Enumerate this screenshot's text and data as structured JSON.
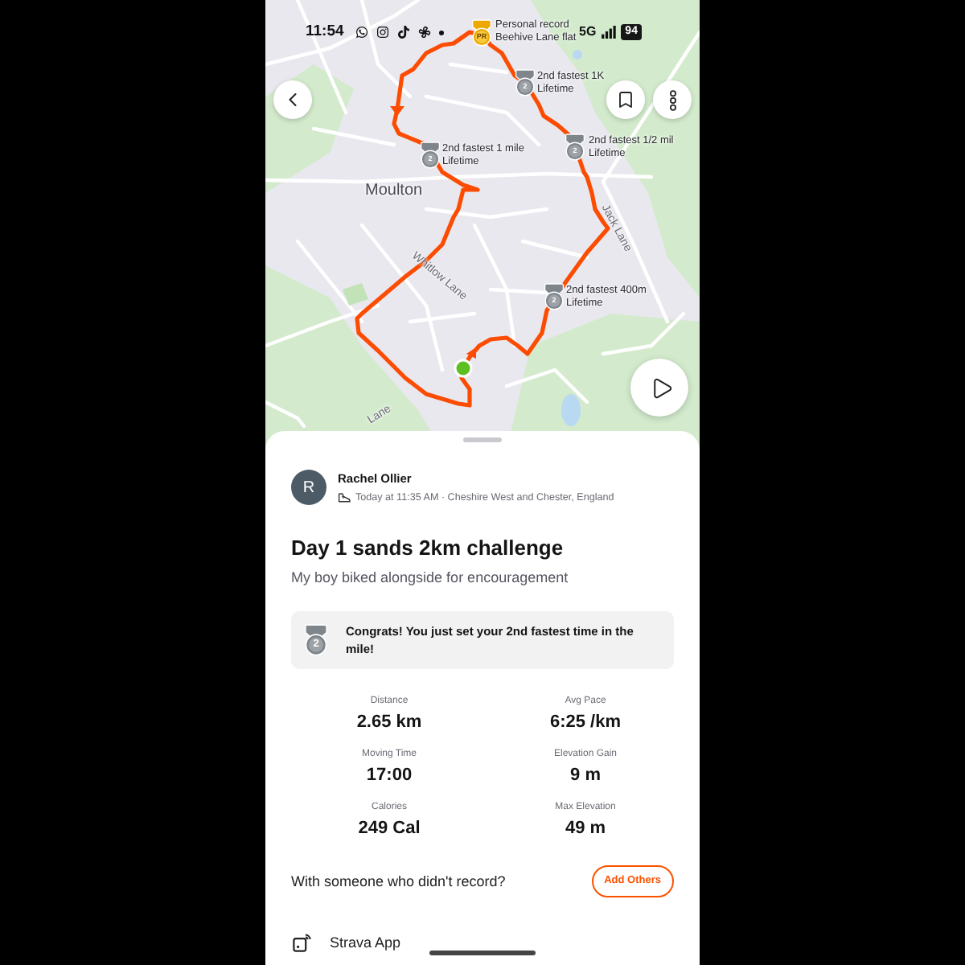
{
  "status_bar": {
    "time": "11:54",
    "network": "5G",
    "battery": "94"
  },
  "map": {
    "place_labels": [
      {
        "text": "Moulton",
        "kind": "place"
      },
      {
        "text": "Whitlow Lane",
        "kind": "street"
      },
      {
        "text": "Jack Lane",
        "kind": "street"
      },
      {
        "text": "Lane",
        "kind": "street"
      }
    ],
    "achievements": [
      {
        "kind": "gold",
        "badge": "PR",
        "title": "Personal record",
        "subtitle": "Beehive Lane flat"
      },
      {
        "kind": "silver",
        "badge": "2",
        "title": "2nd fastest 1K",
        "subtitle": "Lifetime"
      },
      {
        "kind": "silver",
        "badge": "2",
        "title": "2nd fastest 1/2 mil",
        "subtitle": "Lifetime"
      },
      {
        "kind": "silver",
        "badge": "2",
        "title": "2nd fastest 1 mile",
        "subtitle": "Lifetime"
      },
      {
        "kind": "silver",
        "badge": "2",
        "title": "2nd fastest 400m",
        "subtitle": "Lifetime"
      }
    ]
  },
  "athlete": {
    "initial": "R",
    "name": "Rachel Ollier",
    "meta": "Today at 11:35 AM · Cheshire West and Chester, England"
  },
  "activity": {
    "title": "Day 1 sands 2km challenge",
    "description": "My boy biked alongside for encouragement"
  },
  "achievement_banner": {
    "kind": "silver",
    "badge": "2",
    "message": "Congrats! You just set your 2nd fastest time in the mile!"
  },
  "stats": [
    {
      "label": "Distance",
      "value": "2.65 km"
    },
    {
      "label": "Avg Pace",
      "value": "6:25 /km"
    },
    {
      "label": "Moving Time",
      "value": "17:00"
    },
    {
      "label": "Elevation Gain",
      "value": "9 m"
    },
    {
      "label": "Calories",
      "value": "249 Cal"
    },
    {
      "label": "Max Elevation",
      "value": "49 m"
    }
  ],
  "add_others": {
    "prompt": "With someone who didn't record?",
    "button": "Add Others"
  },
  "device": {
    "name": "Strava App"
  }
}
